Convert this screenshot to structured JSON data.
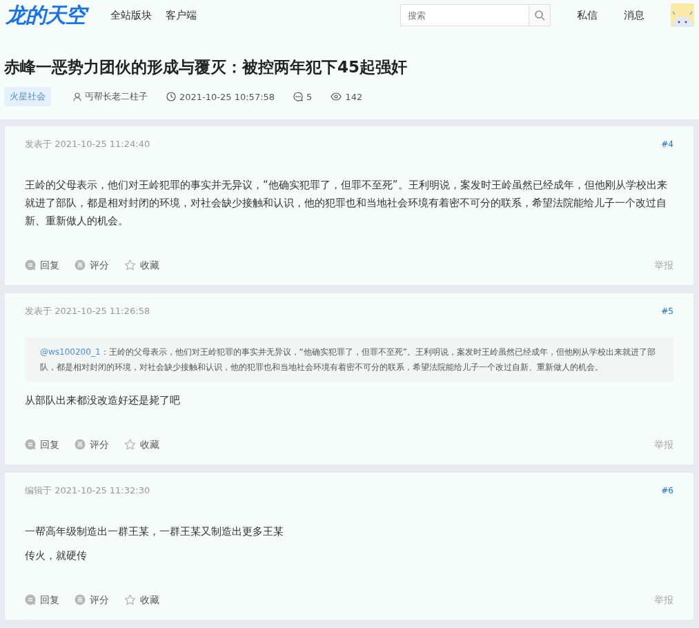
{
  "header": {
    "logo": "龙的天空",
    "nav": [
      "全站版块",
      "客户端"
    ],
    "search": {
      "placeholder": "搜索"
    },
    "links": [
      "私信",
      "消息"
    ]
  },
  "thread": {
    "title": "赤峰一恶势力团伙的形成与覆灭：被控两年犯下45起强奸",
    "tag": "火星社会",
    "author": "丐帮长老二柱子",
    "time": "2021-10-25 10:57:58",
    "replies": "5",
    "views": "142"
  },
  "posts": [
    {
      "meta": "发表于 2021-10-25 11:24:40",
      "floor": "#4",
      "paragraphs": [
        "王岭的父母表示，他们对王岭犯罪的事实并无异议，“他确实犯罪了，但罪不至死”。王利明说，案发时王岭虽然已经成年，但他刚从学校出来就进了部队，都是相对封闭的环境，对社会缺少接触和认识，他的犯罪也和当地社会环境有着密不可分的联系，希望法院能给儿子一个改过自新、重新做人的机会。"
      ],
      "actions": [
        "回复",
        "评分",
        "收藏"
      ],
      "report": "举报"
    },
    {
      "meta": "发表于 2021-10-25 11:26:58",
      "floor": "#5",
      "quote": {
        "user": "@ws100200_1",
        "text": "：王岭的父母表示，他们对王岭犯罪的事实并无异议，“他确实犯罪了，但罪不至死”。王利明说，案发时王岭虽然已经成年，但他刚从学校出来就进了部队，都是相对封闭的环境，对社会缺少接触和认识，他的犯罪也和当地社会环境有着密不可分的联系，希望法院能给儿子一个改过自新、重新做人的机会。"
      },
      "paragraphs": [
        "从部队出来都没改造好还是毙了吧"
      ],
      "actions": [
        "回复",
        "评分",
        "收藏"
      ],
      "report": "举报"
    },
    {
      "meta": "编辑于 2021-10-25 11:32:30",
      "floor": "#6",
      "paragraphs": [
        "一帮高年级制造出一群王某，一群王某又制造出更多王某",
        "传火，就硬传"
      ],
      "actions": [
        "回复",
        "评分",
        "收藏"
      ],
      "report": "举报"
    }
  ]
}
